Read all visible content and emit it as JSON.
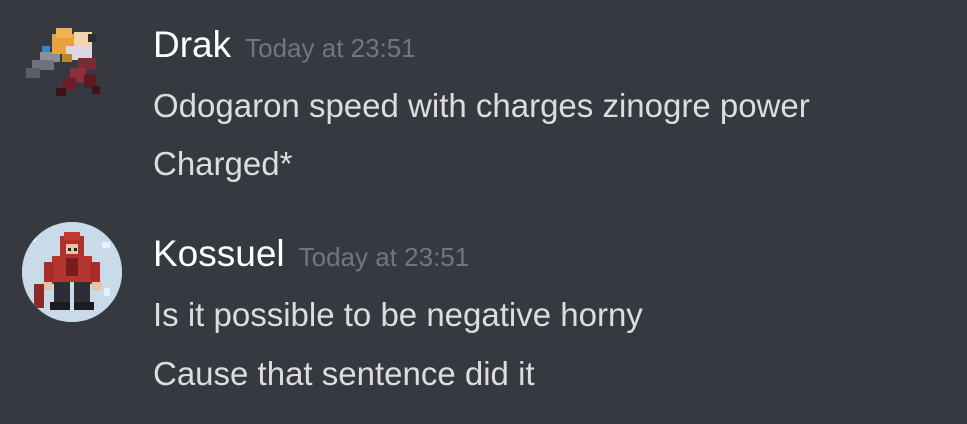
{
  "messages": [
    {
      "username": "Drak",
      "timestamp": "Today at 23:51",
      "lines": [
        "Odogaron speed with charges zinogre power",
        "Charged*"
      ],
      "avatar_icon": "pixel-character-avatar-icon"
    },
    {
      "username": "Kossuel",
      "timestamp": "Today at 23:51",
      "lines": [
        "Is it possible to be negative horny",
        "Cause that sentence did it"
      ],
      "avatar_icon": "pixel-character-avatar-icon"
    }
  ],
  "colors": {
    "background": "#36393f",
    "username": "#ffffff",
    "timestamp": "#72767d",
    "text": "#dcddde"
  }
}
